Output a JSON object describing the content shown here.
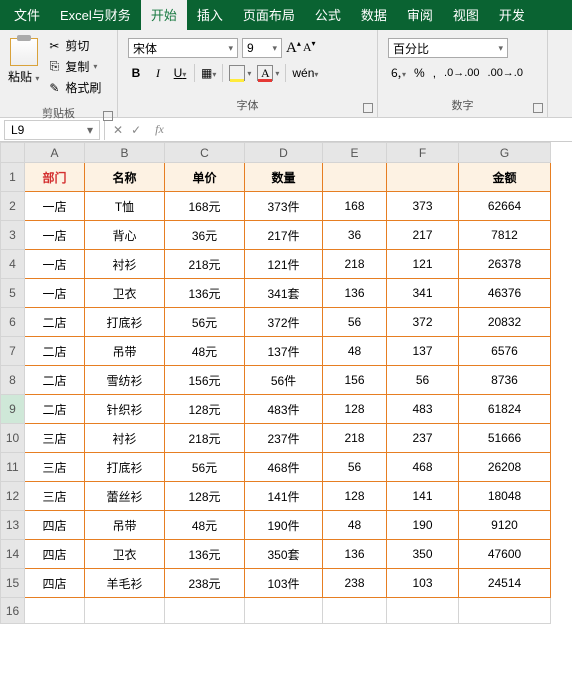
{
  "tabs": [
    "文件",
    "Excel与财务",
    "开始",
    "插入",
    "页面布局",
    "公式",
    "数据",
    "审阅",
    "视图",
    "开发"
  ],
  "active_tab": 2,
  "ribbon": {
    "clipboard": {
      "paste": "粘贴",
      "cut": "剪切",
      "copy": "复制",
      "format_painter": "格式刷",
      "group_label": "剪贴板"
    },
    "font": {
      "name": "宋体",
      "size": "9",
      "bold": "B",
      "italic": "I",
      "underline": "U",
      "wen": "wén",
      "group_label": "字体"
    },
    "number": {
      "format": "百分比",
      "group_label": "数字"
    }
  },
  "namebox": "L9",
  "fx_label": "fx",
  "columns": [
    "A",
    "B",
    "C",
    "D",
    "E",
    "F",
    "G"
  ],
  "headers": {
    "A": "部门",
    "B": "名称",
    "C": "单价",
    "D": "数量",
    "E": "",
    "F": "",
    "G": "金额"
  },
  "rows": [
    {
      "A": "一店",
      "B": "T恤",
      "C": "168元",
      "D": "373件",
      "E": "168",
      "F": "373",
      "G": "62664"
    },
    {
      "A": "一店",
      "B": "背心",
      "C": "36元",
      "D": "217件",
      "E": "36",
      "F": "217",
      "G": "7812"
    },
    {
      "A": "一店",
      "B": "衬衫",
      "C": "218元",
      "D": "121件",
      "E": "218",
      "F": "121",
      "G": "26378"
    },
    {
      "A": "一店",
      "B": "卫衣",
      "C": "136元",
      "D": "341套",
      "E": "136",
      "F": "341",
      "G": "46376"
    },
    {
      "A": "二店",
      "B": "打底衫",
      "C": "56元",
      "D": "372件",
      "E": "56",
      "F": "372",
      "G": "20832"
    },
    {
      "A": "二店",
      "B": "吊带",
      "C": "48元",
      "D": "137件",
      "E": "48",
      "F": "137",
      "G": "6576"
    },
    {
      "A": "二店",
      "B": "雪纺衫",
      "C": "156元",
      "D": "56件",
      "E": "156",
      "F": "56",
      "G": "8736"
    },
    {
      "A": "二店",
      "B": "针织衫",
      "C": "128元",
      "D": "483件",
      "E": "128",
      "F": "483",
      "G": "61824"
    },
    {
      "A": "三店",
      "B": "衬衫",
      "C": "218元",
      "D": "237件",
      "E": "218",
      "F": "237",
      "G": "51666"
    },
    {
      "A": "三店",
      "B": "打底衫",
      "C": "56元",
      "D": "468件",
      "E": "56",
      "F": "468",
      "G": "26208"
    },
    {
      "A": "三店",
      "B": "蕾丝衫",
      "C": "128元",
      "D": "141件",
      "E": "128",
      "F": "141",
      "G": "18048"
    },
    {
      "A": "四店",
      "B": "吊带",
      "C": "48元",
      "D": "190件",
      "E": "48",
      "F": "190",
      "G": "9120"
    },
    {
      "A": "四店",
      "B": "卫衣",
      "C": "136元",
      "D": "350套",
      "E": "136",
      "F": "350",
      "G": "47600"
    },
    {
      "A": "四店",
      "B": "羊毛衫",
      "C": "238元",
      "D": "103件",
      "E": "238",
      "F": "103",
      "G": "24514"
    }
  ],
  "selected_row": 9
}
